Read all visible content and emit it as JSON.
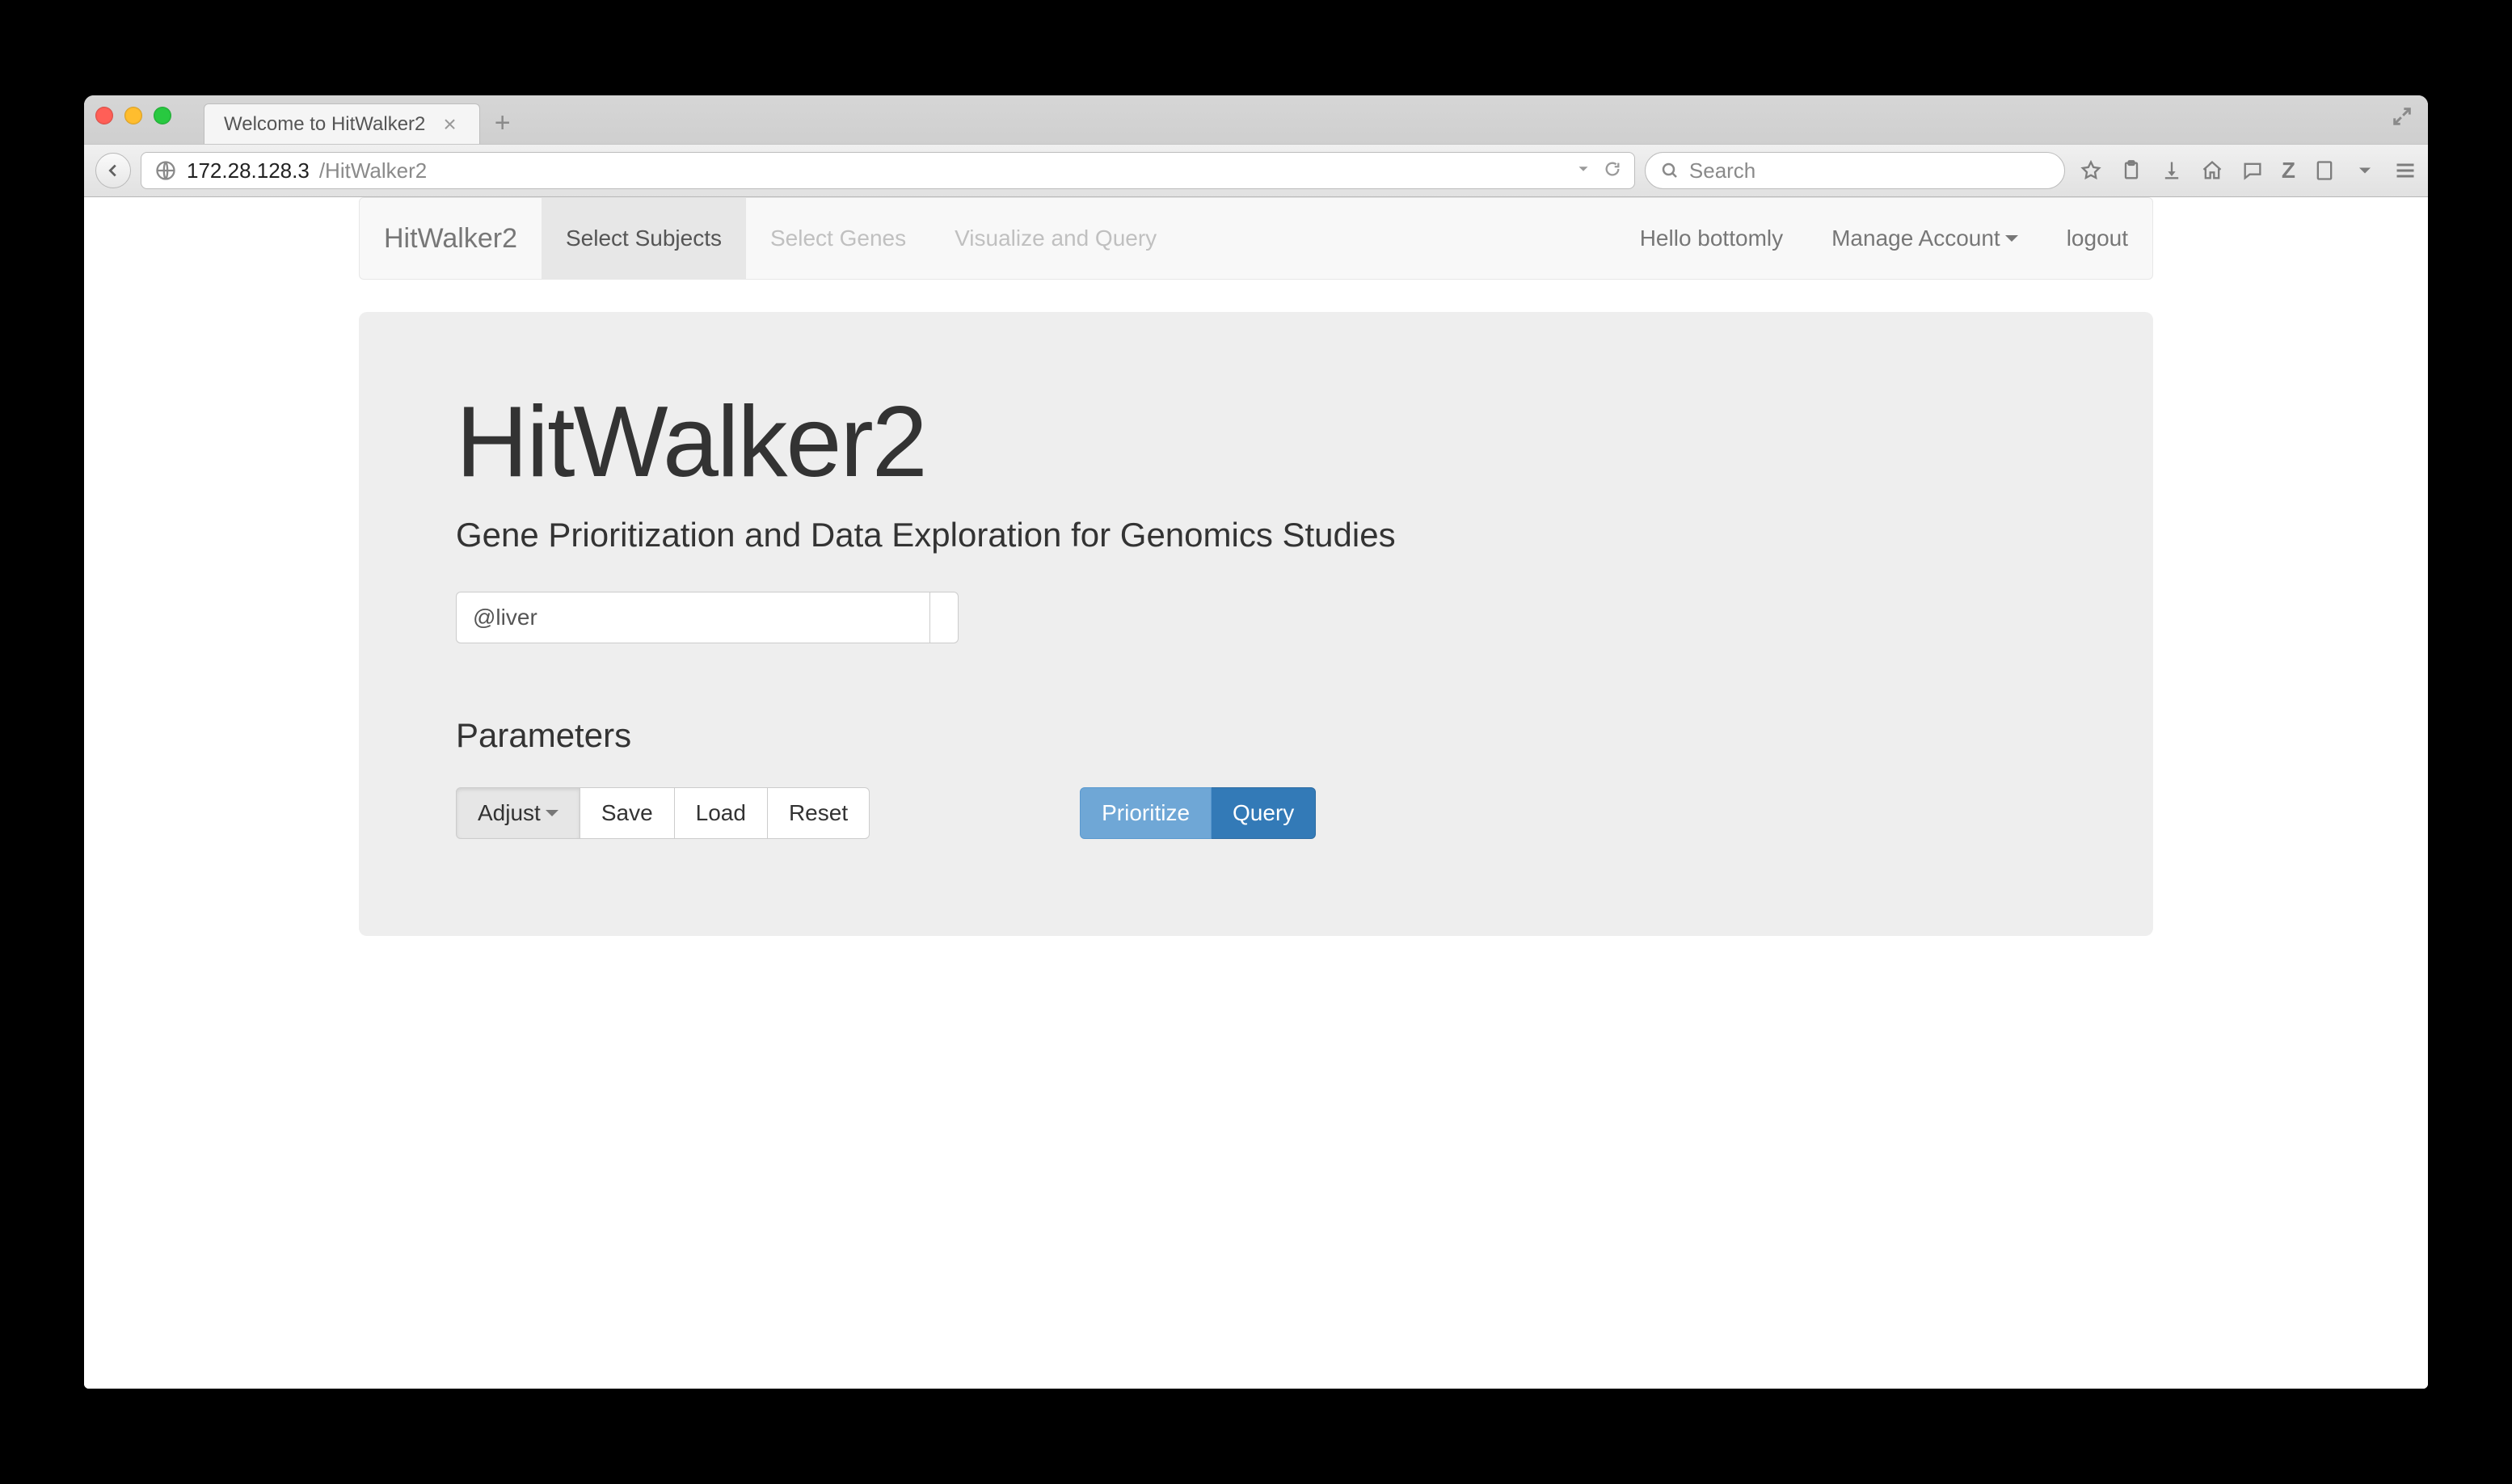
{
  "browser": {
    "tab_title": "Welcome to HitWalker2",
    "url_host": "172.28.128.3",
    "url_path": "/HitWalker2",
    "search_placeholder": "Search"
  },
  "navbar": {
    "brand": "HitWalker2",
    "items": [
      {
        "label": "Select Subjects"
      },
      {
        "label": "Select Genes"
      },
      {
        "label": "Visualize and Query"
      }
    ],
    "right": {
      "greeting": "Hello bottomly",
      "manage": "Manage Account",
      "logout": "logout"
    }
  },
  "main": {
    "title": "HitWalker2",
    "subtitle": "Gene Prioritization and Data Exploration for Genomics Studies",
    "search_value": "@liver",
    "params_heading": "Parameters",
    "buttons": {
      "adjust": "Adjust",
      "save": "Save",
      "load": "Load",
      "reset": "Reset",
      "prioritize": "Prioritize",
      "query": "Query"
    }
  }
}
